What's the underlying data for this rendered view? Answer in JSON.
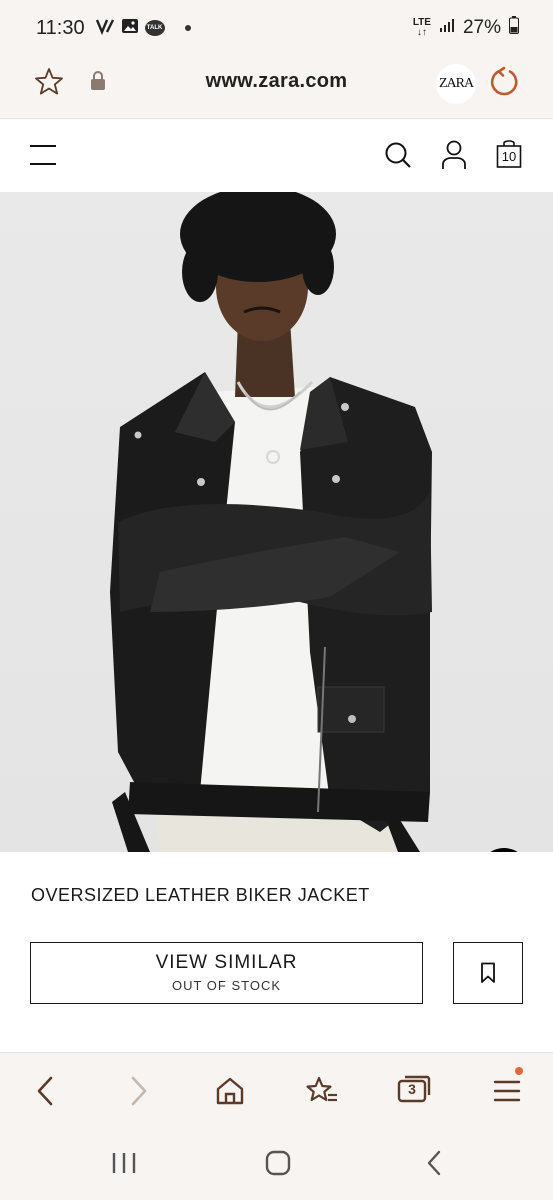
{
  "status_bar": {
    "time": "11:30",
    "battery": "27%",
    "network": "LTE"
  },
  "browser": {
    "url": "www.zara.com",
    "site_favicon_text": "ZARA"
  },
  "site_header": {
    "bag_count": "10"
  },
  "product": {
    "name": "OVERSIZED LEATHER BIKER JACKET",
    "view_similar_label": "VIEW SIMILAR",
    "stock_status": "OUT OF STOCK"
  },
  "browser_toolbar": {
    "tab_count": "3"
  },
  "colors": {
    "chrome_bg": "#f7f4f1",
    "browser_icon": "#5a3b2a",
    "notification_dot": "#e5683a"
  }
}
